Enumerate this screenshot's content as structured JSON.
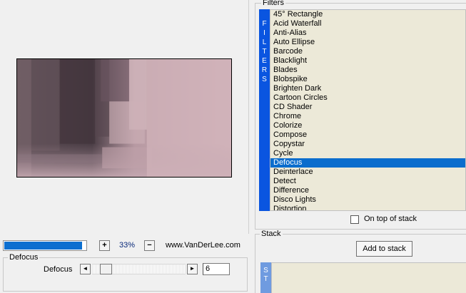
{
  "preview": {
    "zoom_plus": "+",
    "zoom_value": "33%",
    "zoom_minus": "−",
    "website": "www.VanDerLee.com",
    "progress_fraction": 0.94
  },
  "defocus_group": {
    "title": "Defocus",
    "param_label": "Defocus",
    "slider_left": "◄",
    "slider_right": "►",
    "value": "6",
    "slider_fraction": 0.1
  },
  "filters": {
    "title": "Filters",
    "banner": [
      "F",
      "I",
      "L",
      "T",
      "E",
      "R",
      "S"
    ],
    "items": [
      "45° Rectangle",
      "Acid Waterfall",
      "Anti-Alias",
      "Auto Ellipse",
      "Barcode",
      "Blacklight",
      "Blades",
      "Blobspike",
      "Brighten Dark",
      "Cartoon Circles",
      "CD Shader",
      "Chrome",
      "Colorize",
      "Compose",
      "Copystar",
      "Cycle",
      "Defocus",
      "Deinterlace",
      "Detect",
      "Difference",
      "Disco Lights",
      "Distortion"
    ],
    "selected": "Defocus",
    "on_top_label": "On top of stack"
  },
  "stack": {
    "title": "Stack",
    "add_button": "Add to stack",
    "banner": [
      "S",
      "T"
    ]
  },
  "colors": {
    "selection": "#0b6dcd",
    "banner": "#0a55e0",
    "list_bg": "#ece9d8"
  }
}
